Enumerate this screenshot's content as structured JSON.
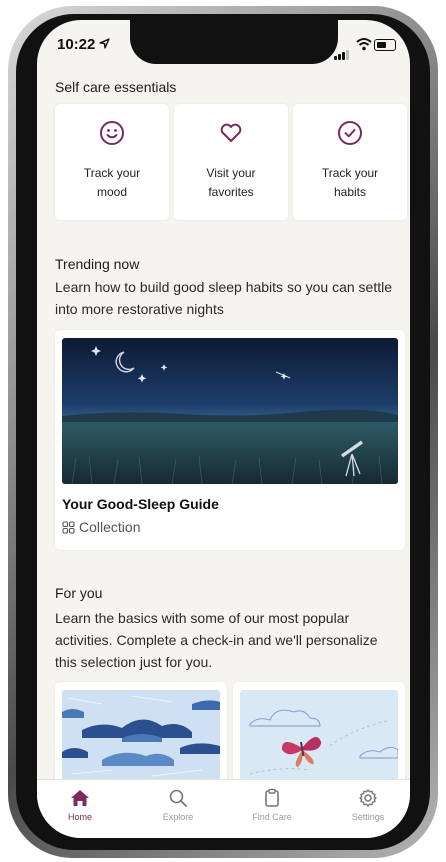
{
  "status_bar": {
    "time": "10:22"
  },
  "self_care": {
    "title": "Self care essentials",
    "items": [
      {
        "label": "Track your\nmood",
        "icon": "smiley-icon"
      },
      {
        "label": "Visit your\nfavorites",
        "icon": "heart-icon"
      },
      {
        "label": "Track your\nhabits",
        "icon": "check-circle-icon"
      }
    ]
  },
  "trending": {
    "title": "Trending now",
    "description": "Learn how to build good sleep habits so you can settle into more restorative nights",
    "card": {
      "title": "Your Good-Sleep Guide",
      "type": "Collection",
      "type_icon": "grid-icon"
    }
  },
  "for_you": {
    "title": "For you",
    "description": "Learn the basics with some of our most popular activities. Complete a check-in and we'll personalize this selection just for you."
  },
  "tabbar": {
    "items": [
      {
        "label": "Home",
        "icon": "home-icon",
        "active": true
      },
      {
        "label": "Explore",
        "icon": "search-icon",
        "active": false
      },
      {
        "label": "Find Care",
        "icon": "clipboard-icon",
        "active": false
      },
      {
        "label": "Settings",
        "icon": "gear-icon",
        "active": false
      }
    ]
  },
  "colors": {
    "accent": "#7a2a5f",
    "background": "#f6f4ef",
    "card": "#ffffff"
  }
}
